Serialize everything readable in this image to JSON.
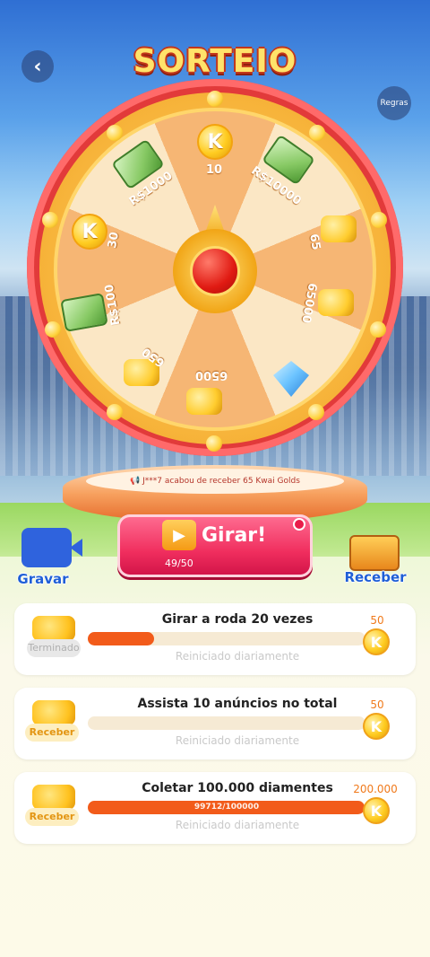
{
  "header": {
    "title": "SORTEIO",
    "back_icon": "chevron-left-icon",
    "rules_label": "Regras"
  },
  "wheel": {
    "segments": [
      {
        "label": "10",
        "prize": "kwai-coin"
      },
      {
        "label": "R$10000",
        "prize": "cash-stack"
      },
      {
        "label": "65",
        "prize": "gold-coins"
      },
      {
        "label": "65000",
        "prize": "gold-coins"
      },
      {
        "label": "",
        "prize": "diamond"
      },
      {
        "label": "6500",
        "prize": "gold-coins"
      },
      {
        "label": "650",
        "prize": "gold-coins"
      },
      {
        "label": "R$100",
        "prize": "cash-stack"
      },
      {
        "label": "30",
        "prize": "kwai-coin"
      },
      {
        "label": "R$1000",
        "prize": "cash-stack"
      }
    ],
    "coin_letter": "K"
  },
  "notice": {
    "text": "J***7 acabou de receber 65 Kwai Golds"
  },
  "spin": {
    "label": "Girar!",
    "count": "49/50"
  },
  "side_actions": {
    "record_label": "Gravar",
    "receive_label": "Receber"
  },
  "tasks": [
    {
      "title": "Girar a roda  20  vezes",
      "subtitle": "Reiniciado diariamente",
      "progress_text": "",
      "progress_fraction": 0.24,
      "reward": "50",
      "action": "Terminado",
      "status": "done"
    },
    {
      "title": "Assista 10 anúncios no total",
      "subtitle": "Reiniciado diariamente",
      "progress_text": "",
      "progress_fraction": 0.0,
      "reward": "50",
      "action": "Receber",
      "status": "receive"
    },
    {
      "title": "Coletar 100.000 diamentes",
      "subtitle": "Reiniciado diariamente",
      "progress_text": "99712/100000",
      "progress_fraction": 0.99712,
      "reward": "200.000",
      "action": "Receber",
      "status": "receive"
    }
  ],
  "colors": {
    "accent": "#f02e5e",
    "progress": "#f25b1a",
    "reward": "#f07a1c",
    "link": "#1f5fd6"
  }
}
